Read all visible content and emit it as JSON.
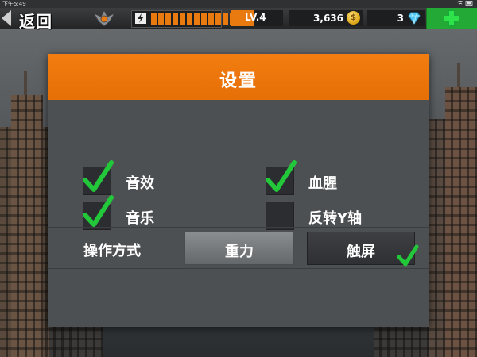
{
  "status_bar": {
    "time": "下午5:49",
    "icons": "wifi-icon battery-icon"
  },
  "top_bar": {
    "back_label": "返回",
    "level": "LV.4",
    "coins": "3,636",
    "coin_symbol": "$",
    "gems": "3",
    "energy_cells": 12,
    "energy_filled": 12
  },
  "dialog": {
    "title": "设置",
    "options": [
      {
        "label": "音效",
        "checked": true
      },
      {
        "label": "音乐",
        "checked": true
      },
      {
        "label": "血腥",
        "checked": true
      },
      {
        "label": "反转Y轴",
        "checked": false
      }
    ],
    "control_mode": {
      "label": "操作方式",
      "gravity": "重力",
      "touch": "触屏",
      "selected": "touch"
    }
  },
  "colors": {
    "accent": "#e87a10",
    "header": "#f27d10",
    "check": "#22c83a",
    "add_button": "#23a935"
  }
}
